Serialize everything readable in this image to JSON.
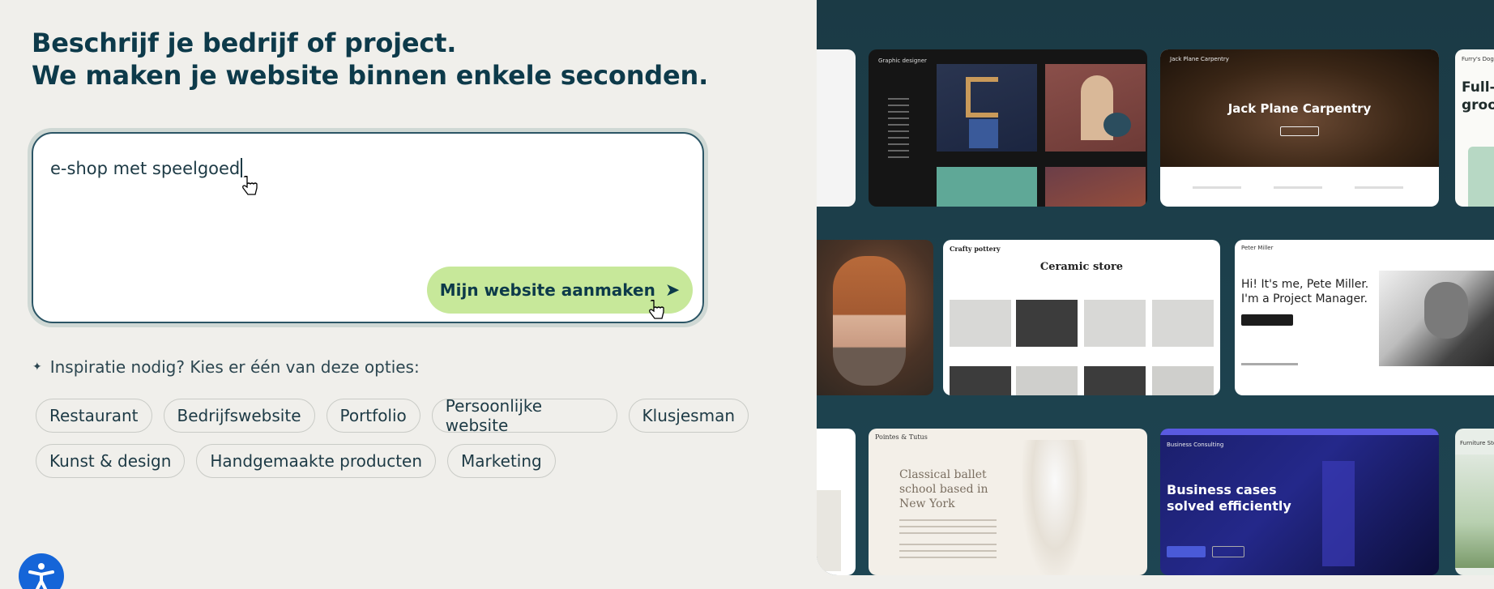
{
  "headline": {
    "line1": "Beschrijf je bedrijf of project.",
    "line2": "We maken je website binnen enkele seconden."
  },
  "prompt": {
    "value": "e-shop met speelgoed",
    "button_label": "Mijn website aanmaken",
    "button_arrow": "➤"
  },
  "inspiration": {
    "label": "Inspiratie nodig? Kies er één van deze opties:",
    "chips_row1": [
      "Restaurant",
      "Bedrijfswebsite",
      "Portfolio",
      "Persoonlijke website",
      "Klusjesman"
    ],
    "chips_row2": [
      "Kunst & design",
      "Handgemaakte producten",
      "Marketing"
    ]
  },
  "templates": {
    "graphic": {
      "title": "Graphic designer"
    },
    "carpentry": {
      "brand": "Jack Plane Carpentry",
      "title": "Jack Plane Carpentry"
    },
    "dog": {
      "brand": "Furry's Dog",
      "headline": "Full-\ngroo"
    },
    "ceramic": {
      "brand": "Crafty pottery",
      "title": "Ceramic store"
    },
    "pete": {
      "brand": "Peter Miller",
      "headline_l1": "Hi! It's me, Pete Miller.",
      "headline_l2": "I'm a Project Manager."
    },
    "ballet": {
      "brand": "Pointes & Tutus",
      "headline": "Classical ballet school based in New York"
    },
    "business": {
      "brand": "Business Consulting",
      "headline_l1": "Business cases",
      "headline_l2": "solved efficiently"
    },
    "furniture": {
      "brand": "Furniture Sto"
    }
  },
  "colors": {
    "accent_green": "#c7e89a",
    "text_dark": "#0d3a4a",
    "right_bg": "#1b3a45",
    "accessibility_blue": "#1565d8"
  }
}
